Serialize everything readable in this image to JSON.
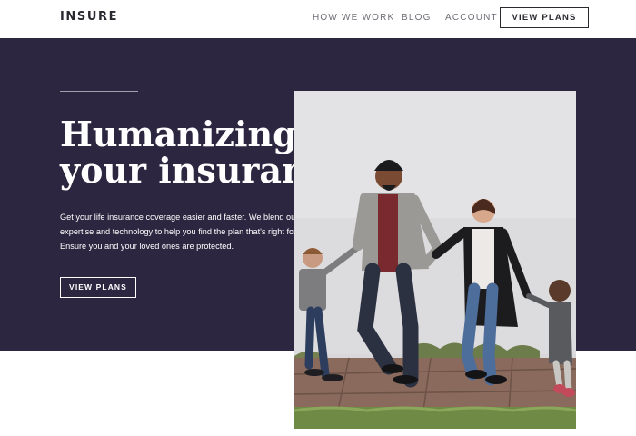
{
  "header": {
    "logo": "INSURE",
    "nav": [
      {
        "label": "HOW WE WORK"
      },
      {
        "label": "BLOG"
      },
      {
        "label": "ACCOUNT"
      }
    ],
    "cta_label": "VIEW PLANS"
  },
  "hero": {
    "title_line1": "Humanizing",
    "title_line2": "your insurance.",
    "description": "Get your life insurance coverage easier and faster. We blend our expertise and technology to help you find the plan that's right for you. Ensure you and your loved ones are protected.",
    "cta_label": "VIEW PLANS",
    "photo_alt": "family-walking-holding-hands"
  },
  "colors": {
    "hero_bg": "#2c2640",
    "text_dark": "#2c2830",
    "nav_text": "#6f6c75",
    "white": "#ffffff"
  }
}
